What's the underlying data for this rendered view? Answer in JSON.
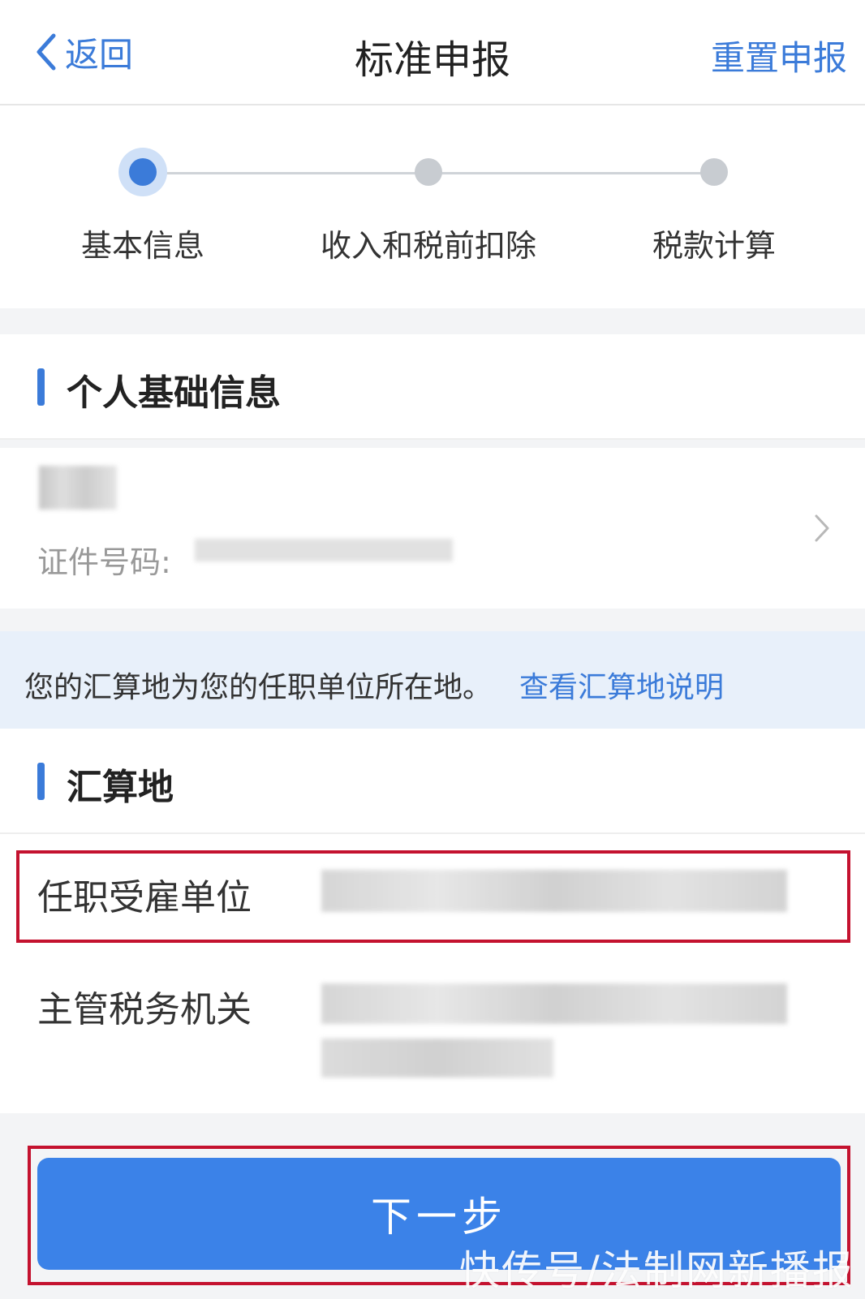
{
  "nav": {
    "back_label": "返回",
    "title": "标准申报",
    "reset_label": "重置申报"
  },
  "steps": [
    {
      "label": "基本信息",
      "state": "active"
    },
    {
      "label": "收入和税前扣除",
      "state": "pending"
    },
    {
      "label": "税款计算",
      "state": "pending"
    }
  ],
  "personal": {
    "section_title": "个人基础信息",
    "id_label": "证件号码:"
  },
  "notice": {
    "text": "您的汇算地为您的任职单位所在地。",
    "link": "查看汇算地说明"
  },
  "location": {
    "section_title": "汇算地",
    "employer_label": "任职受雇单位",
    "tax_authority_label": "主管税务机关"
  },
  "next_button_label": "下一步",
  "watermark": "快传号/法制网新播报",
  "colors": {
    "accent": "#3b7bd9",
    "button": "#3b82e8",
    "highlight_frame": "#c4122f",
    "notice_bg": "#e8f0fa"
  }
}
